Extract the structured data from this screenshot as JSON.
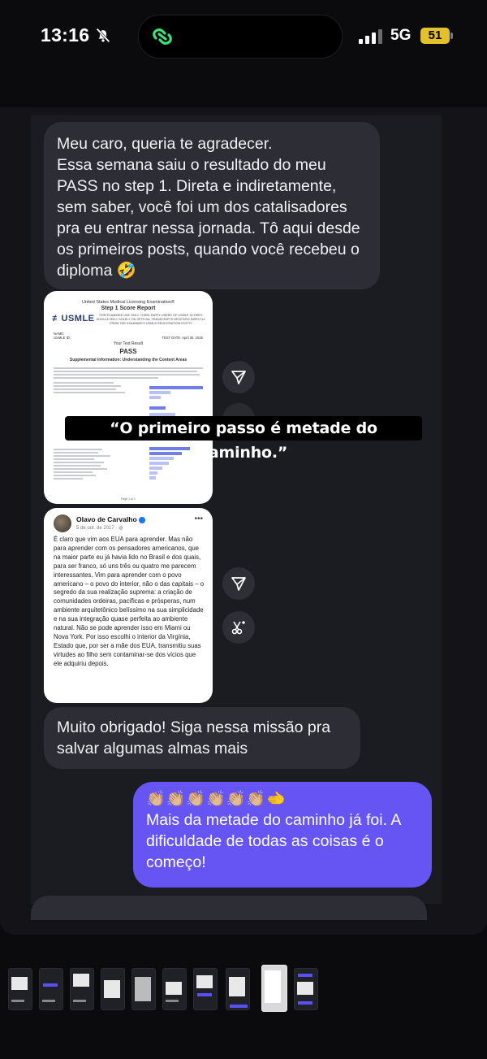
{
  "status_bar": {
    "time": "13:16",
    "network": "5G",
    "battery": "51"
  },
  "messages": {
    "first": "Meu caro, queria te agradecer.\nEssa semana saiu o resultado do meu PASS no step 1. Direta e indiretamente, sem saber, você foi um dos catalisadores pra eu entrar nessa jornada. Tô aqui desde os primeiros posts, quando você recebeu o diploma 🤣",
    "second": "Muito obrigado! Siga nessa missão pra salvar algumas almas mais",
    "reply_emojis": "👏🏼👏🏼👏🏼👏🏼👏🏼👏🏼🫲",
    "reply_text": "Mais da metade do caminho já foi. A dificuldade de todas as coisas é o começo!"
  },
  "usmle_card": {
    "header_line1": "United States Medical Licensing Examination®",
    "header_line2": "Step 1 Score Report",
    "logo": "USMLE",
    "blurb": "FOR EXAMINEE USE ONLY. THIRD-PARTY USERS OF USMLE SCORES SHOULD RELY SOLELY ON OFFICIAL TRANSCRIPTS RECEIVED DIRECTLY FROM THE EXAMINEE'S USMLE REGISTRATION ENTITY",
    "name_label": "NAME:",
    "id_label": "USMLE ID:",
    "test_date": "TEST DATE: April 30, 2025",
    "result_label": "Your Test Result",
    "result": "PASS",
    "subtitle": "Supplemental Information: Understanding the Content Areas",
    "footer": "Page 1 of 1"
  },
  "post_card": {
    "author": "Olavo de Carvalho",
    "date": "5 de out. de 2017 · ",
    "more": "•••",
    "text": "É claro que vim aos EUA para aprender. Mas não para aprender com os pensadores americanos, que na maior parte eu já havia lido no Brasil e dos quais, para ser franco, só uns três ou quatro me parecem interessantes. Vim para aprender com o povo americano – o povo do interior, não o das capitais – o segredo da sua realização suprema: a criação de comunidades ordeiras, pacíficas e prósperas, num ambiente arquitetônico belíssimo na sua simplicidade e na sua integração quase perfeita ao ambiente natural. Não se pode aprender isso em Miami ou Nova York. Por isso escolhi o interior da Virgínia, Estado que, por ser a mãe dos EUA, transmitiu suas virtudes ao filho sem contaminar-se dos vícios que ele adquiriu depois."
  },
  "sticker_text": "“O primeiro passo é metade do caminho.”",
  "colors": {
    "outgoing": "#6655f3",
    "incoming": "#2c2d35",
    "battery": "#e5c02d"
  }
}
